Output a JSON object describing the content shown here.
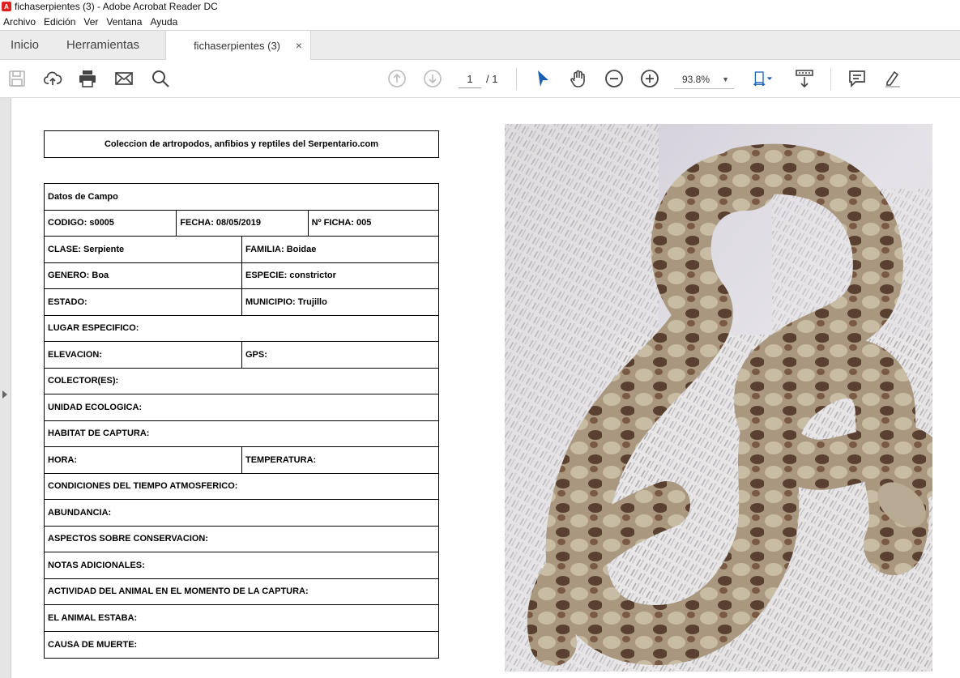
{
  "window": {
    "title": "fichaserpientes (3) - Adobe Acrobat Reader DC"
  },
  "menu": [
    "Archivo",
    "Edición",
    "Ver",
    "Ventana",
    "Ayuda"
  ],
  "tabs": {
    "home": "Inicio",
    "tools": "Herramientas",
    "document": "fichaserpientes (3)",
    "close": "×"
  },
  "toolbar": {
    "page_current": "1",
    "page_total": "/ 1",
    "zoom": "93.8%"
  },
  "document": {
    "title": "Coleccion de artropodos, anfibios y reptiles del Serpentario.com",
    "rows": [
      [
        "Datos de Campo"
      ],
      [
        "CODIGO: s0005",
        "FECHA: 08/05/2019",
        "Nº FICHA: 005"
      ],
      [
        "CLASE: Serpiente",
        "FAMILIA: Boidae"
      ],
      [
        "GENERO: Boa",
        "ESPECIE: constrictor"
      ],
      [
        "ESTADO:",
        "MUNICIPIO: Trujillo"
      ],
      [
        "LUGAR ESPECIFICO:"
      ],
      [
        "ELEVACION:",
        "GPS:"
      ],
      [
        "COLECTOR(ES):"
      ],
      [
        "UNIDAD ECOLOGICA:"
      ],
      [
        "HABITAT DE CAPTURA:"
      ],
      [
        "HORA:",
        "TEMPERATURA:"
      ],
      [
        "CONDICIONES DEL TIEMPO ATMOSFERICO:"
      ],
      [
        "ABUNDANCIA:"
      ],
      [
        "ASPECTOS SOBRE CONSERVACION:"
      ],
      [
        "NOTAS ADICIONALES:"
      ],
      [
        "ACTIVIDAD DEL ANIMAL EN EL MOMENTO DE LA CAPTURA:"
      ],
      [
        "EL ANIMAL ESTABA:"
      ],
      [
        "CAUSA DE MUERTE:"
      ]
    ]
  }
}
